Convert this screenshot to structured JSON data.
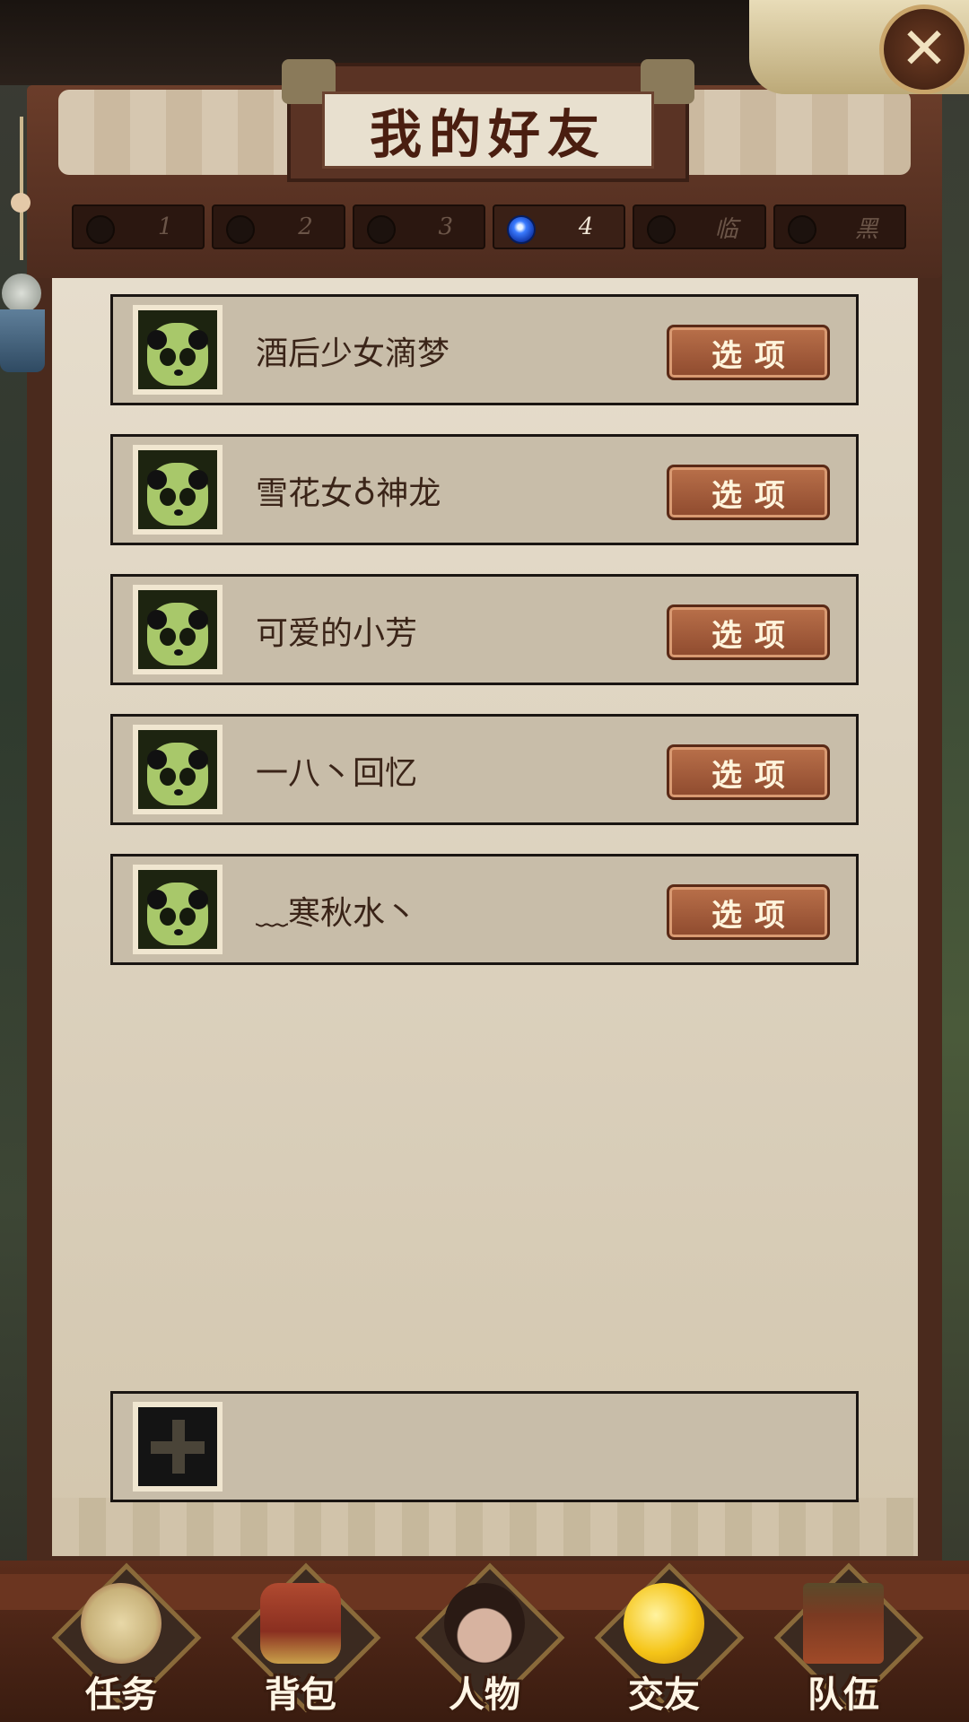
{
  "window": {
    "title": "我的好友",
    "close_label": "✕"
  },
  "tabs": [
    {
      "label": "1",
      "active": false
    },
    {
      "label": "2",
      "active": false
    },
    {
      "label": "3",
      "active": false
    },
    {
      "label": "4",
      "active": true
    },
    {
      "label": "临",
      "active": false
    },
    {
      "label": "黑",
      "active": false
    }
  ],
  "friends": [
    {
      "name": "酒后少女滴梦",
      "option_label": "选项"
    },
    {
      "name": "雪花女♁神龙",
      "option_label": "选项"
    },
    {
      "name": "可爱的小芳",
      "option_label": "选项"
    },
    {
      "name": "一八丶回忆",
      "option_label": "选项"
    },
    {
      "name": "﹏寒秋水丶",
      "option_label": "选项"
    }
  ],
  "nav": [
    {
      "label": "任务",
      "icon": "scroll-icon",
      "color": "#c8b27a"
    },
    {
      "label": "背包",
      "icon": "treasure-chest-icon",
      "color": "#8a2f20"
    },
    {
      "label": "人物",
      "icon": "character-portrait-icon",
      "color": "#c79a86"
    },
    {
      "label": "交友",
      "icon": "smiley-faces-icon",
      "color": "#f5c518"
    },
    {
      "label": "队伍",
      "icon": "banner-flag-icon",
      "color": "#7a3a22"
    }
  ]
}
